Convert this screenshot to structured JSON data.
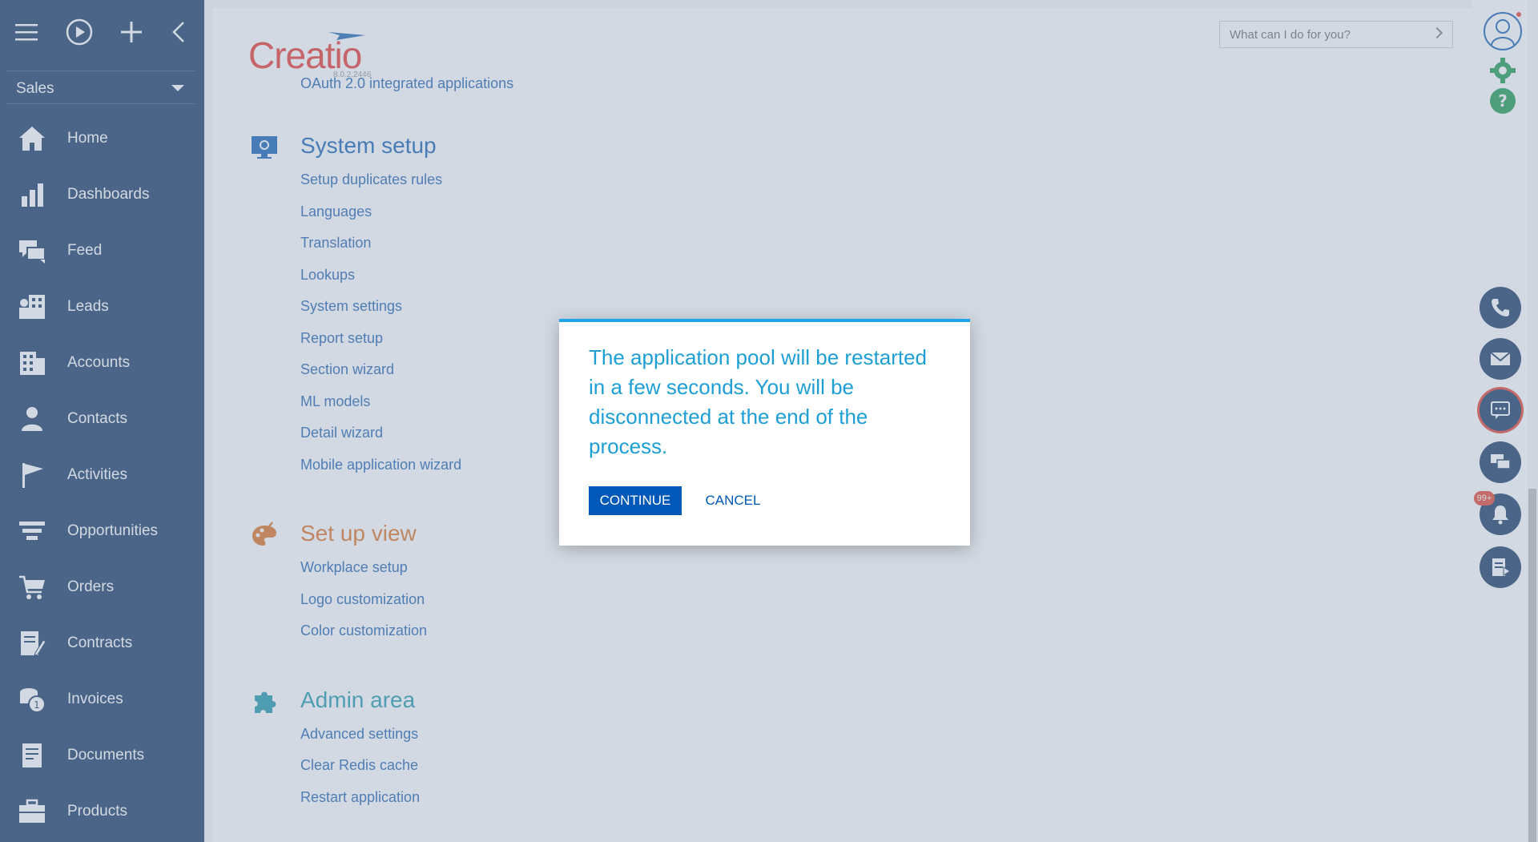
{
  "sidebar": {
    "workplace": "Sales",
    "items": [
      {
        "label": "Home"
      },
      {
        "label": "Dashboards"
      },
      {
        "label": "Feed"
      },
      {
        "label": "Leads"
      },
      {
        "label": "Accounts"
      },
      {
        "label": "Contacts"
      },
      {
        "label": "Activities"
      },
      {
        "label": "Opportunities"
      },
      {
        "label": "Orders"
      },
      {
        "label": "Contracts"
      },
      {
        "label": "Invoices"
      },
      {
        "label": "Documents"
      },
      {
        "label": "Products"
      }
    ]
  },
  "header": {
    "logo": "Creatio",
    "version": "8.0.2.2446",
    "search_placeholder": "What can I do for you?"
  },
  "main": {
    "oauth_link": "OAuth 2.0 integrated applications",
    "sections": [
      {
        "title": "System setup",
        "links": [
          "Setup duplicates rules",
          "Languages",
          "Translation",
          "Lookups",
          "System settings",
          "Report setup",
          "Section wizard",
          "ML models",
          "Detail wizard",
          "Mobile application wizard"
        ]
      },
      {
        "title": "Set up view",
        "links": [
          "Workplace setup",
          "Logo customization",
          "Color customization"
        ]
      },
      {
        "title": "Admin area",
        "links": [
          "Advanced settings",
          "Clear Redis cache",
          "Restart application"
        ]
      }
    ]
  },
  "rail": {
    "notification_badge": "99+"
  },
  "modal": {
    "message": "The application pool will be restarted in a few seconds. You will be disconnected at the end of the process.",
    "continue_label": "CONTINUE",
    "cancel_label": "CANCEL"
  },
  "colors": {
    "sidebar_bg": "#22446d",
    "link": "#2a6bb6",
    "section_title": "#1f69b8",
    "modal_text": "#1d9fd6",
    "primary_button": "#0058b8",
    "logo": "#e8453c",
    "set_up_view_title": "#e07a30",
    "admin_area_title": "#2a9fb3"
  }
}
